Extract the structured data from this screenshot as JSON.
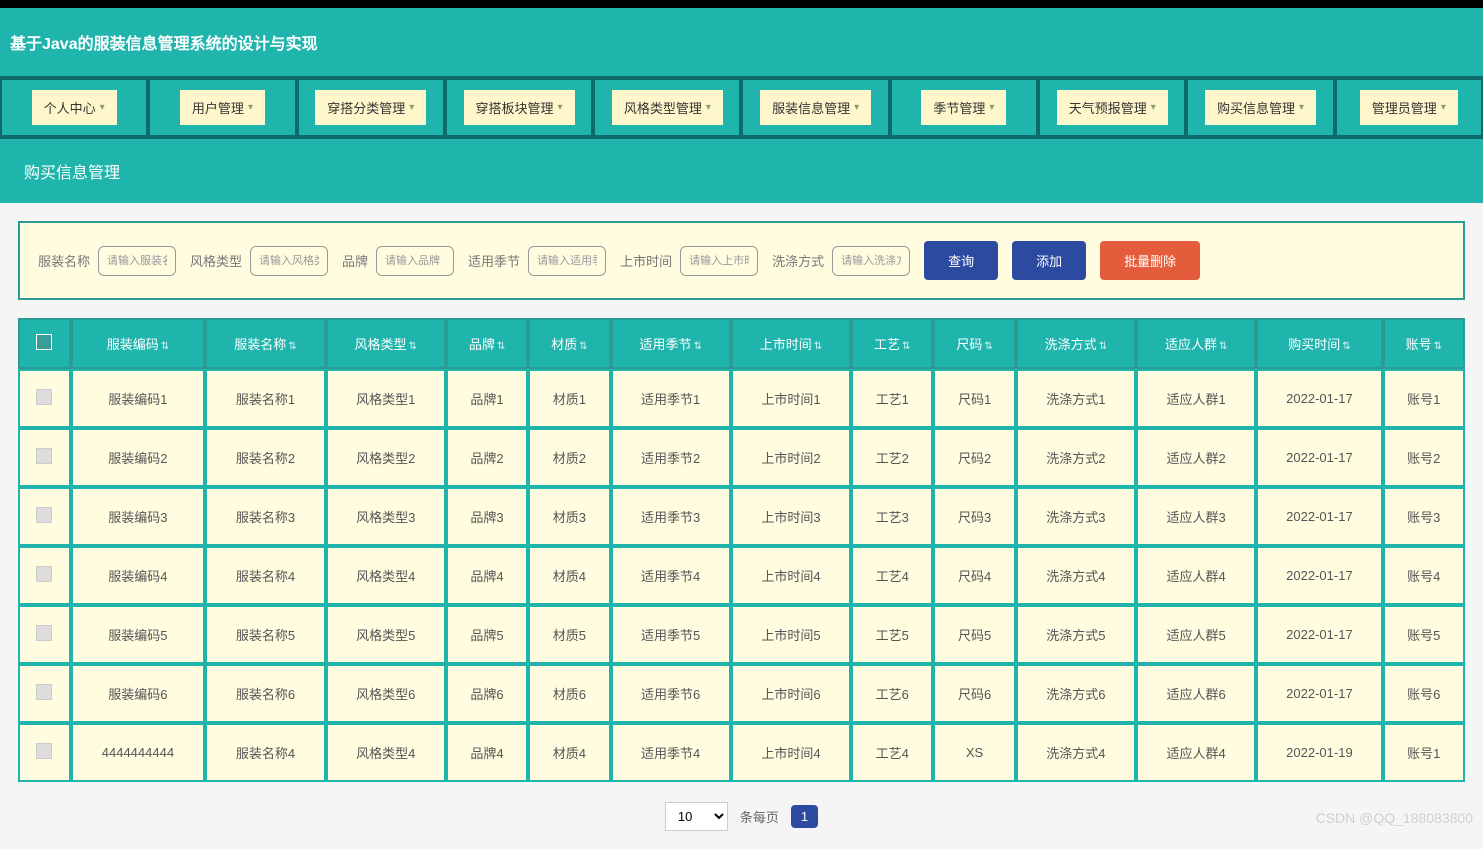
{
  "header": {
    "title": "基于Java的服装信息管理系统的设计与实现"
  },
  "nav": {
    "items": [
      "个人中心",
      "用户管理",
      "穿搭分类管理",
      "穿搭板块管理",
      "风格类型管理",
      "服装信息管理",
      "季节管理",
      "天气预报管理",
      "购买信息管理",
      "管理员管理"
    ]
  },
  "section": {
    "title": "购买信息管理"
  },
  "filters": {
    "f1": {
      "label": "服装名称",
      "placeholder": "请输入服装名"
    },
    "f2": {
      "label": "风格类型",
      "placeholder": "请输入风格类"
    },
    "f3": {
      "label": "品牌",
      "placeholder": "请输入品牌"
    },
    "f4": {
      "label": "适用季节",
      "placeholder": "请输入适用季"
    },
    "f5": {
      "label": "上市时间",
      "placeholder": "请输入上市时"
    },
    "f6": {
      "label": "洗涤方式",
      "placeholder": "请输入洗涤方"
    }
  },
  "actions": {
    "query": "查询",
    "add": "添加",
    "batch_delete": "批量删除"
  },
  "table": {
    "headers": [
      "服装编码",
      "服装名称",
      "风格类型",
      "品牌",
      "材质",
      "适用季节",
      "上市时间",
      "工艺",
      "尺码",
      "洗涤方式",
      "适应人群",
      "购买时间",
      "账号"
    ],
    "rows": [
      [
        "服装编码1",
        "服装名称1",
        "风格类型1",
        "品牌1",
        "材质1",
        "适用季节1",
        "上市时间1",
        "工艺1",
        "尺码1",
        "洗涤方式1",
        "适应人群1",
        "2022-01-17",
        "账号1"
      ],
      [
        "服装编码2",
        "服装名称2",
        "风格类型2",
        "品牌2",
        "材质2",
        "适用季节2",
        "上市时间2",
        "工艺2",
        "尺码2",
        "洗涤方式2",
        "适应人群2",
        "2022-01-17",
        "账号2"
      ],
      [
        "服装编码3",
        "服装名称3",
        "风格类型3",
        "品牌3",
        "材质3",
        "适用季节3",
        "上市时间3",
        "工艺3",
        "尺码3",
        "洗涤方式3",
        "适应人群3",
        "2022-01-17",
        "账号3"
      ],
      [
        "服装编码4",
        "服装名称4",
        "风格类型4",
        "品牌4",
        "材质4",
        "适用季节4",
        "上市时间4",
        "工艺4",
        "尺码4",
        "洗涤方式4",
        "适应人群4",
        "2022-01-17",
        "账号4"
      ],
      [
        "服装编码5",
        "服装名称5",
        "风格类型5",
        "品牌5",
        "材质5",
        "适用季节5",
        "上市时间5",
        "工艺5",
        "尺码5",
        "洗涤方式5",
        "适应人群5",
        "2022-01-17",
        "账号5"
      ],
      [
        "服装编码6",
        "服装名称6",
        "风格类型6",
        "品牌6",
        "材质6",
        "适用季节6",
        "上市时间6",
        "工艺6",
        "尺码6",
        "洗涤方式6",
        "适应人群6",
        "2022-01-17",
        "账号6"
      ],
      [
        "4444444444",
        "服装名称4",
        "风格类型4",
        "品牌4",
        "材质4",
        "适用季节4",
        "上市时间4",
        "工艺4",
        "XS",
        "洗涤方式4",
        "适应人群4",
        "2022-01-19",
        "账号1"
      ]
    ]
  },
  "pagination": {
    "page_size": "10",
    "per_page_label": "条每页",
    "current_page": "1"
  },
  "watermark": "CSDN @QQ_188083800"
}
